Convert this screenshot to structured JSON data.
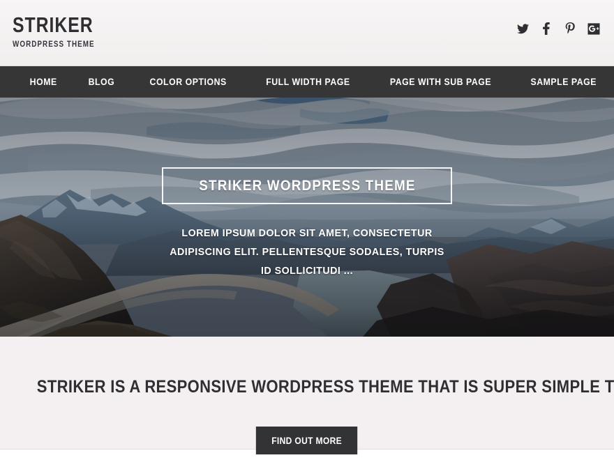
{
  "header": {
    "brand_title": "STRIKER",
    "brand_tagline": "WORDPRESS THEME",
    "social": [
      {
        "name": "twitter-icon",
        "label": "Twitter"
      },
      {
        "name": "facebook-icon",
        "label": "Facebook"
      },
      {
        "name": "pinterest-icon",
        "label": "Pinterest"
      },
      {
        "name": "google-plus-icon",
        "label": "Google Plus"
      }
    ]
  },
  "nav": {
    "items": [
      {
        "label": "HOME"
      },
      {
        "label": "BLOG"
      },
      {
        "label": "COLOR OPTIONS"
      },
      {
        "label": "FULL WIDTH PAGE"
      },
      {
        "label": "PAGE WITH SUB PAGE"
      },
      {
        "label": "SAMPLE PAGE"
      }
    ]
  },
  "hero": {
    "title": "STRIKER WORDPRESS THEME",
    "subtitle": "LOREM IPSUM DOLOR SIT AMET, CONSECTETUR ADIPISCING ELIT. PELLENTESQUE SODALES, TURPIS ID SOLLICITUDI ...",
    "image_alt": "mountain valley with winding dirt road and reservoir lake"
  },
  "callout": {
    "heading": "STRIKER IS A RESPONSIVE WORDPRESS THEME THAT IS SUPER SIMPLE TO CUSTOMIZE",
    "button_label": "FIND OUT MORE"
  },
  "colors": {
    "header_bg": "#f3f1f1",
    "nav_bg": "#363636",
    "nav_text": "#ffffff",
    "callout_bg": "#f4f0f1",
    "button_bg": "#333335",
    "heading_text": "#2f2f33",
    "hero_text": "#ffffff"
  }
}
